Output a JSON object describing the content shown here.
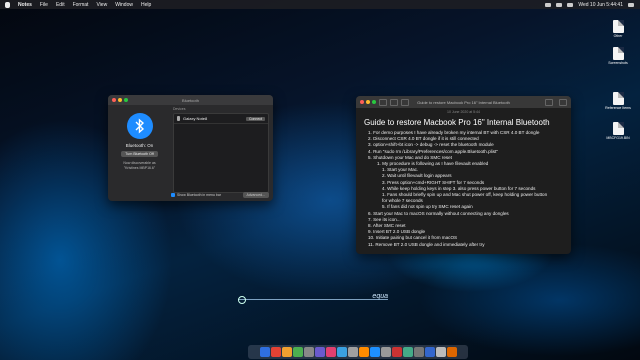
{
  "menubar": {
    "app": "Notes",
    "items": [
      "File",
      "Edit",
      "Format",
      "View",
      "Window",
      "Help"
    ],
    "clock": "Wed 10 Jun 5:44:41"
  },
  "desktop_icons": [
    {
      "label": "Other"
    },
    {
      "label": "Screenshots"
    },
    {
      "label": "Reference Items"
    },
    {
      "label": "MBCFG19.BIN"
    }
  ],
  "bluetooth": {
    "window_title": "Bluetooth",
    "state": "Bluetooth: On",
    "toggle_label": "Turn Bluetooth Off",
    "discoverable_line1": "Now discoverable as",
    "discoverable_line2": "\"Kristines MBP16.6\"",
    "devices_header": "Devices",
    "devices": [
      {
        "name": "Galaxy Note8",
        "action": "Connect"
      }
    ],
    "show_menu_bar": "Show Bluetooth in menu bar",
    "advanced": "Advanced..."
  },
  "notes": {
    "window_title": "Guide to restore Macbook Pro 16\" Internal Bluetooth",
    "date": "10 June 2020 at 5:44",
    "heading": "Guide to restore Macbook Pro 16\" Internal Bluetooth",
    "lines": [
      {
        "text": "1. For demo purposes I have already broken my internal BT with CSR 4.0 BT dongle",
        "lvl": "i1"
      },
      {
        "text": "2. Disconnect CSR 4.0 BT dongle if it is still connected",
        "lvl": "i1"
      },
      {
        "text": "3. option+shift+bt icon -> debug -> reset the bluetooth module",
        "lvl": "i1"
      },
      {
        "text": "4. Run \"sudo rm /Library/Preferences/com.apple.Bluetooth.plist\"",
        "lvl": "i1"
      },
      {
        "text": "5. Shutdown your Mac and do SMC reset",
        "lvl": "i1"
      },
      {
        "text": "1. My procedure is following as I have filevault enabled",
        "lvl": "i2"
      },
      {
        "text": "1. Start your Mac.",
        "lvl": "i3"
      },
      {
        "text": "2. Wait until filevault login appears",
        "lvl": "i3"
      },
      {
        "text": "3. Press option+cmd+RIGHT SHIFT for 7 seconds",
        "lvl": "i3"
      },
      {
        "text": "4. While keep holding keys in step 3. also press power button for 7 seconds",
        "lvl": "i3"
      },
      {
        "text": "1. Fans should briefly spin up and Mac shut power off, keep holding power button",
        "lvl": "i3"
      },
      {
        "text": "for whole 7 seconds",
        "lvl": "i3"
      },
      {
        "text": "5. If fans did not spin up try SMC reset again",
        "lvl": "i3"
      },
      {
        "text": "6. Start your Mac to macOS normally without connecting any dongles",
        "lvl": "i1"
      },
      {
        "text": "7. See its icon...",
        "lvl": "i1"
      },
      {
        "text": "8. After SMC reset",
        "lvl": "i1"
      },
      {
        "text": "9. Insert BT 2.0 USB dongle",
        "lvl": "i1"
      },
      {
        "text": "10. Initiate pairing but cancel it from macOS",
        "lvl": "i1"
      },
      {
        "text": "11. Remove BT 2.0 USB dongle and immediately after try",
        "lvl": "i1"
      }
    ]
  },
  "wallpaper_text": "equa",
  "dock_colors": [
    "#2f6fe0",
    "#e34234",
    "#f0a030",
    "#4caf50",
    "#888888",
    "#6a5acd",
    "#e04070",
    "#3aa0e0",
    "#a0a0a0",
    "#ff8c00",
    "#1e90ff",
    "#999999",
    "#cc3333",
    "#44aa88",
    "#777777",
    "#3366cc",
    "#bbbbbb",
    "#dd6600"
  ]
}
